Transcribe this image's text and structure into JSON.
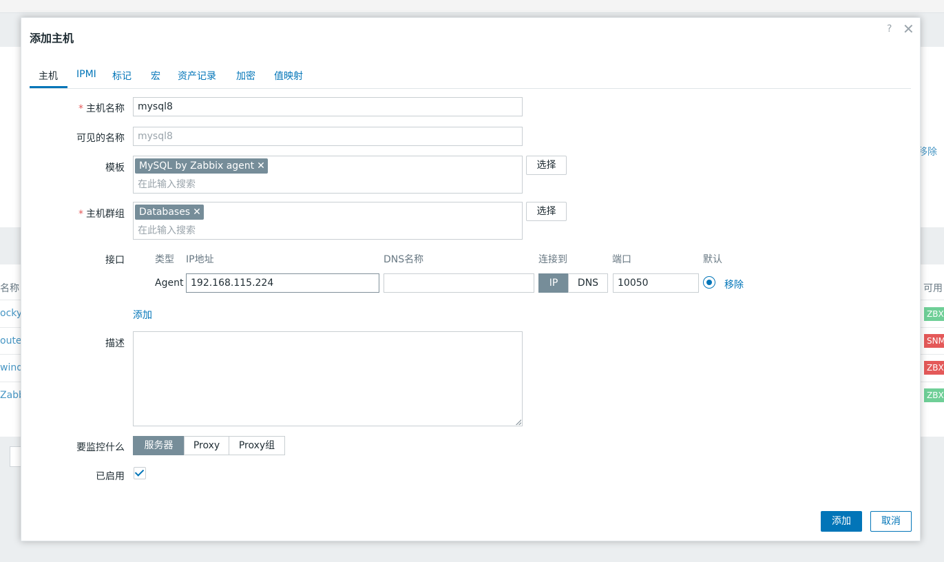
{
  "background": {
    "table_header_left": "名称",
    "table_header_right": "可用",
    "side_link": "移除",
    "rows": [
      {
        "name_fragment": "ocky",
        "badge": "ZBX",
        "badge_color": "#6fcf97"
      },
      {
        "name_fragment": "outer",
        "badge": "SNM",
        "badge_color": "#e45959"
      },
      {
        "name_fragment": "windo",
        "badge": "ZBX",
        "badge_color": "#e45959"
      },
      {
        "name_fragment": "Zabbi",
        "badge": "ZBX",
        "badge_color": "#6fcf97"
      }
    ]
  },
  "modal": {
    "title": "添加主机",
    "help_glyph": "?",
    "close_glyph": "✕",
    "tabs": [
      {
        "label": "主机",
        "active": true
      },
      {
        "label": "IPMI"
      },
      {
        "label": "标记"
      },
      {
        "label": "宏"
      },
      {
        "label": "资产记录"
      },
      {
        "label": "加密"
      },
      {
        "label": "值映射"
      }
    ],
    "form": {
      "required_mark": "*",
      "host_name": {
        "label": "主机名称",
        "value": "mysql8"
      },
      "visible_name": {
        "label": "可见的名称",
        "placeholder": "mysql8"
      },
      "templates": {
        "label": "模板",
        "chip": "MySQL by Zabbix agent",
        "placeholder": "在此输入搜索",
        "select_button": "选择"
      },
      "host_groups": {
        "label": "主机群组",
        "chip": "Databases",
        "placeholder": "在此输入搜索",
        "select_button": "选择"
      },
      "interfaces": {
        "label": "接口",
        "columns": {
          "type": "类型",
          "ip": "IP地址",
          "dns": "DNS名称",
          "connect": "连接到",
          "port": "端口",
          "default": "默认"
        },
        "row": {
          "type": "Agent",
          "ip": "192.168.115.224",
          "dns": "",
          "connect_ip": "IP",
          "connect_dns": "DNS",
          "port": "10050",
          "remove": "移除"
        },
        "add_link": "添加"
      },
      "description": {
        "label": "描述",
        "value": ""
      },
      "monitored_by": {
        "label": "要监控什么",
        "options": [
          "服务器",
          "Proxy",
          "Proxy组"
        ],
        "selected": "服务器"
      },
      "enabled": {
        "label": "已启用",
        "checked": true
      }
    },
    "buttons": {
      "add": "添加",
      "cancel": "取消"
    },
    "accent_color": "#0275b8"
  }
}
